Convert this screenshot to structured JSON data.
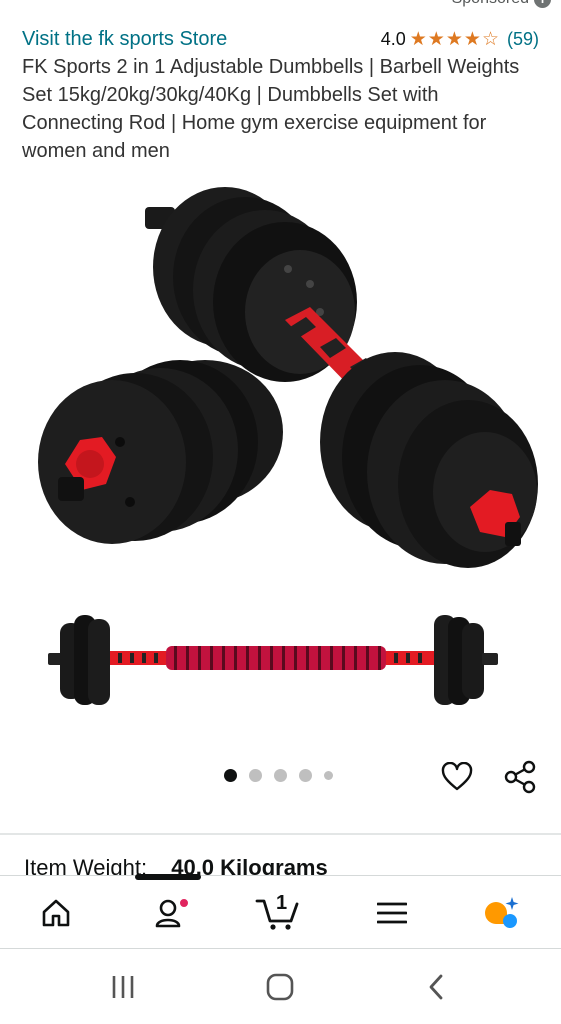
{
  "header": {
    "sponsored_label": "Sponsored",
    "store_link": "Visit the fk sports Store",
    "rating_value": "4.0",
    "rating_stars": 4,
    "rating_count": "(59)"
  },
  "product": {
    "title": "FK Sports 2 in 1 Adjustable Dumbbells | Barbell Weights Set 15kg/20kg/30kg/40Kg | Dumbbells Set with Connecting Rod | Home gym exercise equipment for women and men",
    "carousel": {
      "total_dots": 5,
      "active_index": 0
    },
    "item_weight_label": "Item Weight:",
    "item_weight_value": "40.0 Kilograms"
  },
  "bottom_nav": {
    "items": [
      {
        "name": "home",
        "icon": "home-icon"
      },
      {
        "name": "account",
        "icon": "person-icon"
      },
      {
        "name": "cart",
        "icon": "cart-icon",
        "badge": "1"
      },
      {
        "name": "menu",
        "icon": "hamburger-icon"
      },
      {
        "name": "rufus",
        "icon": "rufus-icon"
      }
    ]
  },
  "colors": {
    "link": "#007185",
    "star": "#de7921",
    "brand_orange": "#ff9900",
    "assistant_blue": "#1a98ff",
    "dumbbell_red": "#e31b23"
  }
}
